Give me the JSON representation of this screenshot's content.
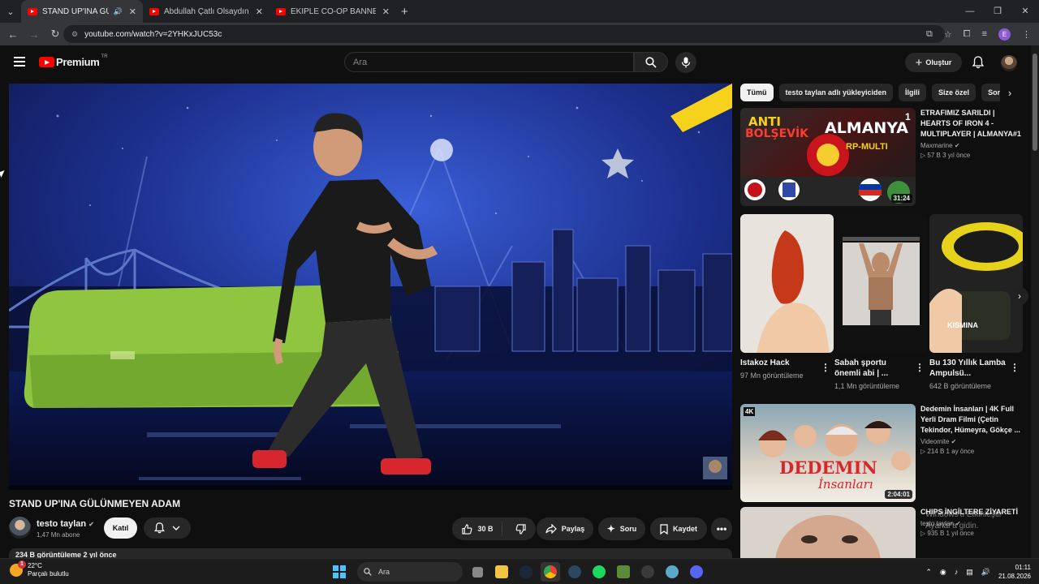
{
  "browser": {
    "tabs": [
      {
        "title": "STAND UP'INA GÜLÜNMEYEN",
        "active": true
      },
      {
        "title": "Abdullah Çatlı Olsaydın? (DERİN",
        "active": false
      },
      {
        "title": "EKİPLE CO-OP BANNERLORD -",
        "active": false
      }
    ],
    "url": "youtube.com/watch?v=2YHKxJUC53c",
    "profile_initial": "E"
  },
  "youtube": {
    "logo_text": "Premium",
    "country_code": "TR",
    "search_placeholder": "Ara",
    "create_label": "Oluştur"
  },
  "video": {
    "title": "STAND UP'INA GÜLÜNMEYEN ADAM",
    "channel": "testo taylan",
    "subscribers": "1,47 Mn abone",
    "join_label": "Katıl",
    "likes": "30 B",
    "share_label": "Paylaş",
    "ask_label": "Soru",
    "save_label": "Kaydet",
    "views_line": "234 B görüntüleme  2 yıl önce"
  },
  "chips": [
    "Tümü",
    "testo taylan adlı yükleyiciden",
    "İlgili",
    "Size özel",
    "Son"
  ],
  "recommendations": [
    {
      "title": "ETRAFIMIZ SARILDI | HEARTS OF IRON 4 - MULTIPLAYER | ALMANYA#1",
      "channel": "Maxmarine",
      "stats": "57 B  3 yıl önce",
      "duration": "31:24"
    },
    {
      "title": "Dedemin İnsanları | 4K Full Yerli Dram Filmi (Çetin Tekindor, Hümeyra, Gökçe ...",
      "channel": "Videomite",
      "stats": "214 B  1 ay önce",
      "duration": "2:04:01"
    },
    {
      "title": "CHIPS İNGİLTERE ZİYARETİ",
      "channel": "testo taylan",
      "stats": "935 B  1 yıl önce",
      "duration": ""
    }
  ],
  "shorts": [
    {
      "title": "Istakoz Hack",
      "views": "97 Mn görüntüleme"
    },
    {
      "title": "Sabah şportu önemli abi | ...",
      "views": "1,1 Mn görüntüleme"
    },
    {
      "title": "Bu 130 Yıllık Lamba Ampulsü...",
      "views": "642 B görüntüleme"
    }
  ],
  "thumb_text": {
    "anti": "ANTI",
    "bolsevik": "BOLŞEVİK",
    "almanya": "ALMANYA",
    "rp_multi": "RP-MULTI",
    "episode": "1",
    "dedemin": "DEDEMIN",
    "insanlari": "İnsanları",
    "k4": "4K",
    "kismina": "KISMINA"
  },
  "watermark": [
    "Windows'u Etkinleştir",
    "Ayarlar'a gidin."
  ],
  "taskbar": {
    "temp": "22°C",
    "weather": "Parçalı bulutlu",
    "weather_badge": "1",
    "search_placeholder": "Ara",
    "time": "01:11",
    "date": "21.08.2026"
  },
  "colors": {
    "youtube_red": "#ff0000",
    "background": "#0f0f0f",
    "chip_active": "#f1f1f1"
  }
}
